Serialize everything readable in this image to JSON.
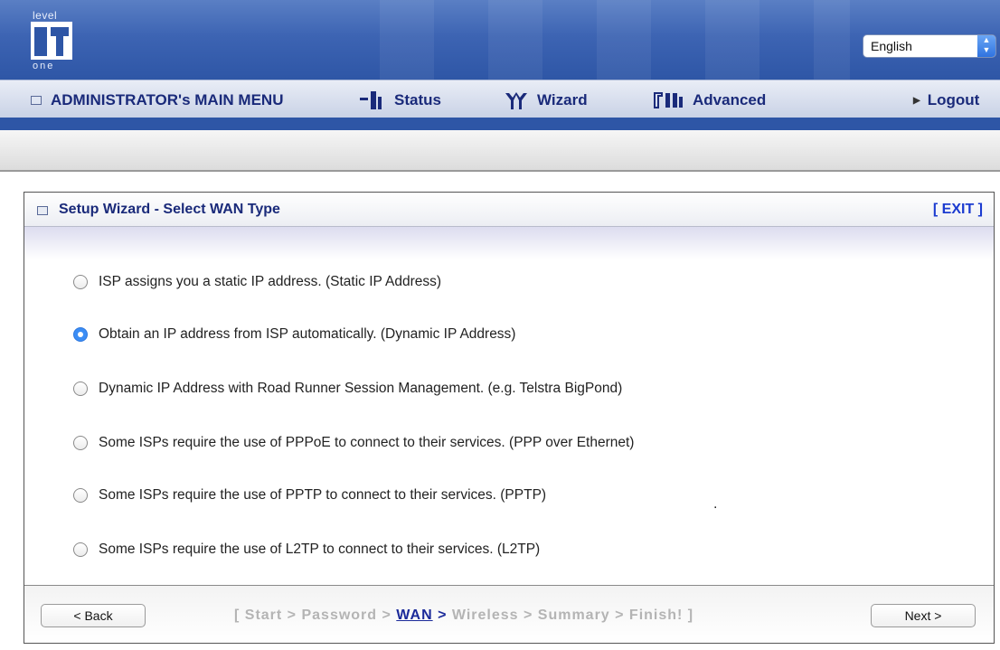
{
  "header": {
    "logo": {
      "top_text": "level",
      "bottom_text": "one"
    },
    "language": {
      "selected": "English"
    }
  },
  "menu": {
    "main_menu_label": "ADMINISTRATOR's MAIN MENU",
    "status_label": "Status",
    "wizard_label": "Wizard",
    "advanced_label": "Advanced",
    "logout_label": "Logout"
  },
  "panel": {
    "title": "Setup Wizard - Select WAN Type",
    "exit_label": "[ EXIT ]",
    "options": [
      {
        "label": "ISP assigns you a static IP address. (Static IP Address)",
        "selected": false
      },
      {
        "label": "Obtain an IP address from ISP automatically. (Dynamic IP Address)",
        "selected": true
      },
      {
        "label": "Dynamic IP Address with Road Runner Session Management. (e.g. Telstra BigPond)",
        "selected": false
      },
      {
        "label": "Some ISPs require the use of PPPoE to connect to their services. (PPP over Ethernet)",
        "selected": false
      },
      {
        "label": "Some ISPs require the use of PPTP to connect to their services. (PPTP)",
        "selected": false
      },
      {
        "label": "Some ISPs require the use of L2TP to connect to their services. (L2TP)",
        "selected": false
      }
    ],
    "stray_dot": "."
  },
  "footer": {
    "back_label": "< Back",
    "next_label": "Next >",
    "steps": {
      "open": "[ ",
      "start": "Start",
      "password": "Password",
      "wan": "WAN",
      "wireless": "Wireless",
      "summary": "Summary",
      "finish": "Finish!",
      "close": " ]",
      "sep": " > "
    }
  },
  "colors": {
    "banner": "#3d64b3",
    "menu_text": "#1a2a7a",
    "radio_selected": "#3b8df5",
    "current_step": "#1b2a9a",
    "inactive_step": "#b4b4b4"
  }
}
